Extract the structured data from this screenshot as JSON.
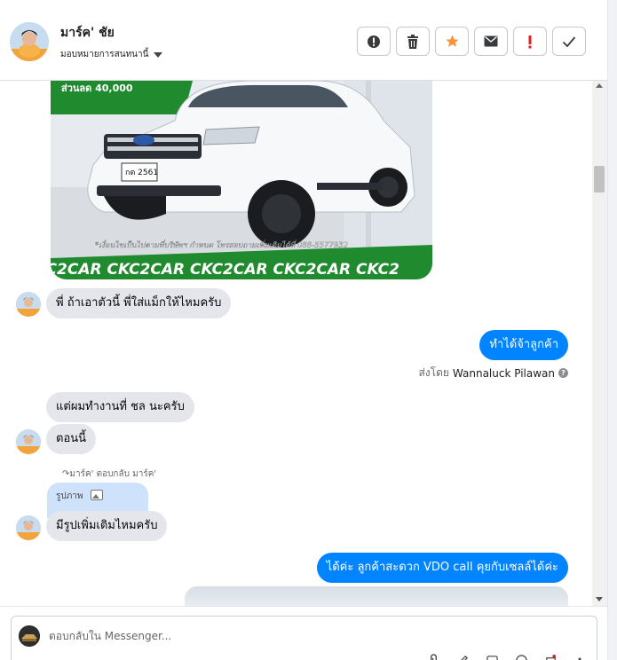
{
  "header": {
    "contact_name": "มาร์ค' ชัย",
    "assignment_label": "มอบหมายการสนทนานี้"
  },
  "toolbar": {
    "buttons": [
      "spam",
      "delete",
      "star",
      "mark-unread",
      "important",
      "done"
    ]
  },
  "car_image": {
    "banner_text": "ส่วนลด 40,000",
    "plate_text": "กต 2561",
    "footer_note": "*เงื่อนไขเป็นไปตามที่บริษัทฯ กำหนด โทรสอบถามเพิ่มเติมได้ที่ 088-5577932",
    "brand_strip": "CKC2CAR CKC2CAR CKC2CAR CKC2CAR CKC2",
    "strip_color": "#1f8a2e"
  },
  "messages": {
    "m1": "พี่ ถ้าเอาตัวนี้ พี่ใส่แม็กให้ไหมครับ",
    "m2": "ทำได้จ้าลูกค้า",
    "sent_by_prefix": "ส่งโดย",
    "sent_by_name": "Wannaluck Pilawan",
    "m3": "แต่ผมทำงานที่ ชล นะครับ",
    "m4": "ตอนนี้",
    "reply_label": "มาร์ค' ตอบกลับ มาร์ค'",
    "quoted_label": "รูปภาพ",
    "m5": "มีรูปเพิ่มเติมไหมครับ",
    "m6": "ได้ค่ะ ลูกค้าสะดวก VDO call คุยกับเซลล์ได้ค่ะ"
  },
  "composer": {
    "placeholder": "ตอบกลับใน Messenger..."
  },
  "colors": {
    "outgoing": "#0084ff",
    "incoming": "#e4e6eb",
    "star": "#f7923a",
    "important": "#e02020"
  }
}
